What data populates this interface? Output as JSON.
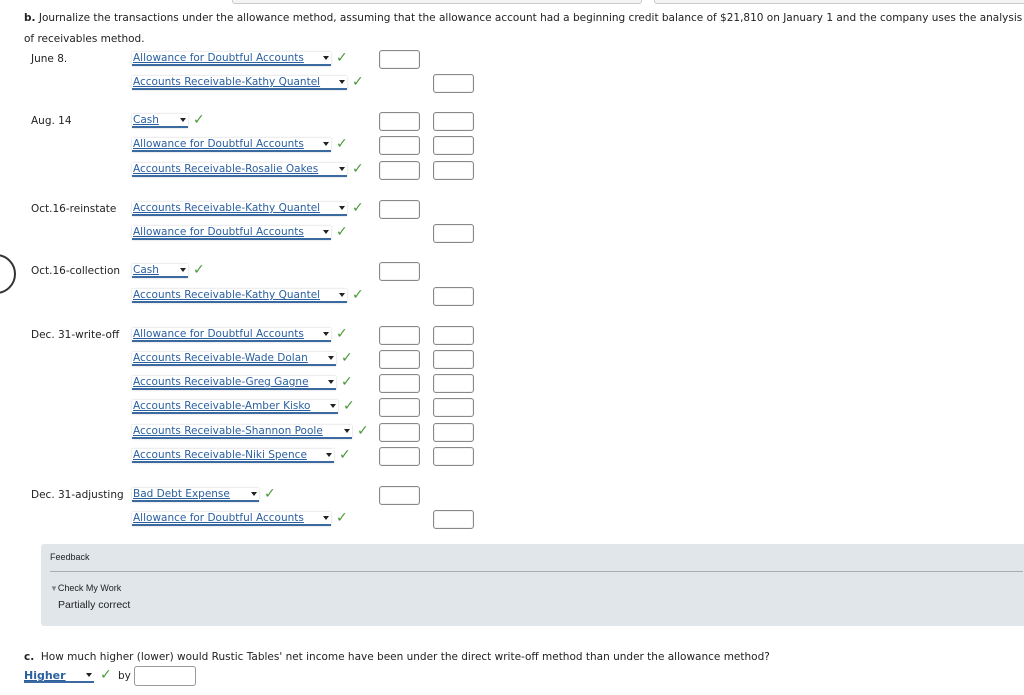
{
  "intro": {
    "label": "b.",
    "text": "Journalize the transactions under the allowance method, assuming that the allowance account had a beginning credit balance of $21,810 on January 1 and the company uses the analysis",
    "text2": "of receivables method."
  },
  "colors": {
    "link": "#2a5fa0",
    "check": "#4a9a3a",
    "feedback_bg": "#e1e6ea"
  },
  "check_icon": "check-icon",
  "entries": [
    {
      "date": "June 8.",
      "account": "Allowance for Doubtful Accounts",
      "correct": true,
      "debit": true,
      "credit": false
    },
    {
      "date": "",
      "account": "Accounts Receivable-Kathy Quantel",
      "correct": true,
      "debit": false,
      "credit": true
    },
    {
      "date": "Aug. 14",
      "account": "Cash",
      "correct": true,
      "debit": true,
      "credit": true
    },
    {
      "date": "",
      "account": "Allowance for Doubtful Accounts",
      "correct": true,
      "debit": true,
      "credit": true
    },
    {
      "date": "",
      "account": "Accounts Receivable-Rosalie Oakes",
      "correct": true,
      "debit": true,
      "credit": true
    },
    {
      "date": "Oct.16-reinstate",
      "account": "Accounts Receivable-Kathy Quantel",
      "correct": true,
      "debit": true,
      "credit": false
    },
    {
      "date": "",
      "account": "Allowance for Doubtful Accounts",
      "correct": true,
      "debit": false,
      "credit": true
    },
    {
      "date": "Oct.16-collection",
      "account": "Cash",
      "correct": true,
      "debit": true,
      "credit": false
    },
    {
      "date": "",
      "account": "Accounts Receivable-Kathy Quantel",
      "correct": true,
      "debit": false,
      "credit": true
    },
    {
      "date": "Dec. 31-write-off",
      "account": "Allowance for Doubtful Accounts",
      "correct": true,
      "debit": true,
      "credit": true
    },
    {
      "date": "",
      "account": "Accounts Receivable-Wade Dolan",
      "correct": true,
      "debit": true,
      "credit": true
    },
    {
      "date": "",
      "account": "Accounts Receivable-Greg Gagne",
      "correct": true,
      "debit": true,
      "credit": true
    },
    {
      "date": "",
      "account": "Accounts Receivable-Amber Kisko",
      "correct": true,
      "debit": true,
      "credit": true
    },
    {
      "date": "",
      "account": "Accounts Receivable-Shannon Poole",
      "correct": true,
      "debit": true,
      "credit": true
    },
    {
      "date": "",
      "account": "Accounts Receivable-Niki Spence",
      "correct": true,
      "debit": true,
      "credit": true
    },
    {
      "date": "Dec. 31-adjusting",
      "account": "Bad Debt Expense",
      "correct": true,
      "debit": true,
      "credit": false
    },
    {
      "date": "",
      "account": "Allowance for Doubtful Accounts",
      "correct": true,
      "debit": false,
      "credit": true
    }
  ],
  "feedback": {
    "title": "Feedback",
    "check_my_work": "Check My Work",
    "status": "Partially correct"
  },
  "part_c": {
    "label": "c.",
    "question": "How much higher (lower) would Rustic Tables' net income have been under the direct write-off method than under the allowance method?",
    "selected": "Higher",
    "by": "by",
    "amount": ""
  }
}
